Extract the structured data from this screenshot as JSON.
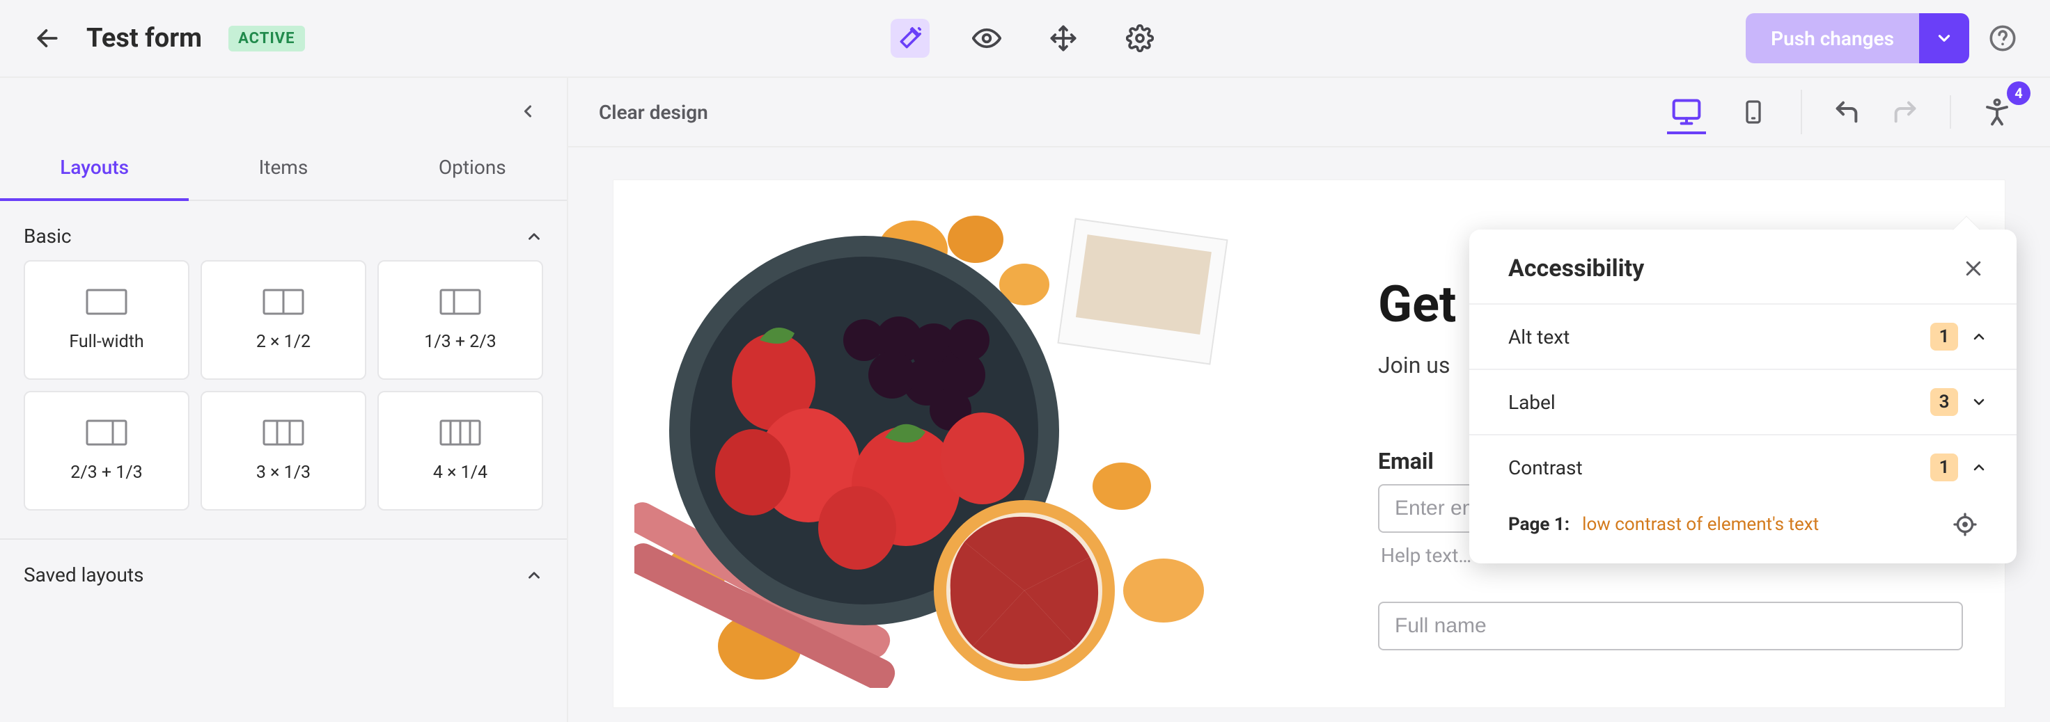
{
  "header": {
    "title": "Test form",
    "badge": "ACTIVE",
    "push_label": "Push changes",
    "access_badge": "4"
  },
  "sidebar": {
    "tabs": {
      "layouts": "Layouts",
      "items": "Items",
      "options": "Options"
    },
    "section_basic": "Basic",
    "layouts": {
      "full": "Full-width",
      "h2": "2 × 1/2",
      "t13_23": "1/3 + 2/3",
      "t23_13": "2/3 + 1/3",
      "h3": "3 × 1/3",
      "q4": "4 × 1/4"
    },
    "section_saved": "Saved layouts"
  },
  "toolbar": {
    "clear": "Clear design"
  },
  "preview": {
    "heading": "Get I",
    "sub": "Join us",
    "email_label": "Email",
    "email_placeholder": "Enter email",
    "help": "Help text…",
    "fullname_placeholder": "Full name"
  },
  "a11y": {
    "title": "Accessibility",
    "rows": {
      "alt": {
        "label": "Alt text",
        "count": "1"
      },
      "label": {
        "label": "Label",
        "count": "3"
      },
      "contrast": {
        "label": "Contrast",
        "count": "1"
      }
    },
    "issue": {
      "page": "Page 1:",
      "msg": "low contrast of element's text"
    }
  }
}
